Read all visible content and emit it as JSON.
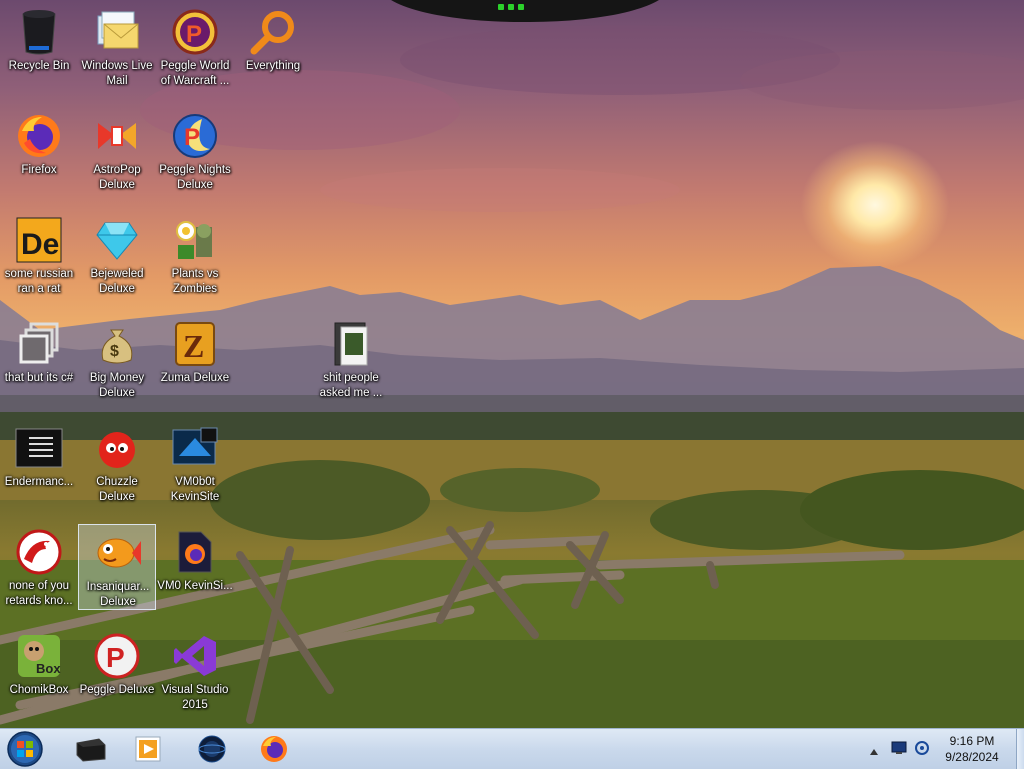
{
  "desktop": {
    "icons": [
      {
        "label": "Recycle Bin",
        "icon": "recycle-bin-icon"
      },
      {
        "label": "Windows Live Mail",
        "icon": "mail-icon"
      },
      {
        "label": "Peggle World of Warcraft ...",
        "icon": "peggle-icon"
      },
      {
        "label": "Everything",
        "icon": "magnifier-icon"
      },
      {
        "label": "Firefox",
        "icon": "firefox-icon"
      },
      {
        "label": "AstroPop Deluxe",
        "icon": "astropop-icon"
      },
      {
        "label": "Peggle Nights Deluxe",
        "icon": "peggle-nights-icon"
      },
      {
        "label": "some russian ran a rat",
        "icon": "de-icon"
      },
      {
        "label": "Bejeweled Deluxe",
        "icon": "diamond-icon"
      },
      {
        "label": "Plants vs Zombies",
        "icon": "plants-vs-zombies-icon"
      },
      {
        "label": "that but its c#",
        "icon": "windows-stack-icon"
      },
      {
        "label": "Big Money Deluxe",
        "icon": "money-bag-icon"
      },
      {
        "label": "Zuma Deluxe",
        "icon": "zuma-icon"
      },
      {
        "label": "shit people asked me ...",
        "icon": "folder-icon"
      },
      {
        "label": "Endermanc...",
        "icon": "console-icon"
      },
      {
        "label": "Chuzzle Deluxe",
        "icon": "chuzzle-icon"
      },
      {
        "label": "VM0b0t KevinSite",
        "icon": "vm-icon"
      },
      {
        "label": "none of you retards kno...",
        "icon": "red-dragon-icon"
      },
      {
        "label": "Insaniquar... Deluxe",
        "icon": "fish-icon"
      },
      {
        "label": "VM0 KevinSi...",
        "icon": "firefox-file-icon"
      },
      {
        "label": "ChomikBox",
        "icon": "chomikbox-icon"
      },
      {
        "label": "Peggle Deluxe",
        "icon": "peggle-icon"
      },
      {
        "label": "Visual Studio 2015",
        "icon": "visual-studio-icon"
      }
    ]
  },
  "taskbar": {
    "start": "start-orb-icon",
    "pinned": [
      "black-box-icon",
      "media-player-icon",
      "globe-icon",
      "firefox-icon"
    ],
    "tray": [
      "show-hidden-icons",
      "network-icon",
      "volume-icon"
    ],
    "clock": {
      "time": "9:16 PM",
      "date": "9/28/2024"
    }
  },
  "colors": {
    "taskbar": "#cad9ec",
    "label_text": "#ffffff"
  }
}
